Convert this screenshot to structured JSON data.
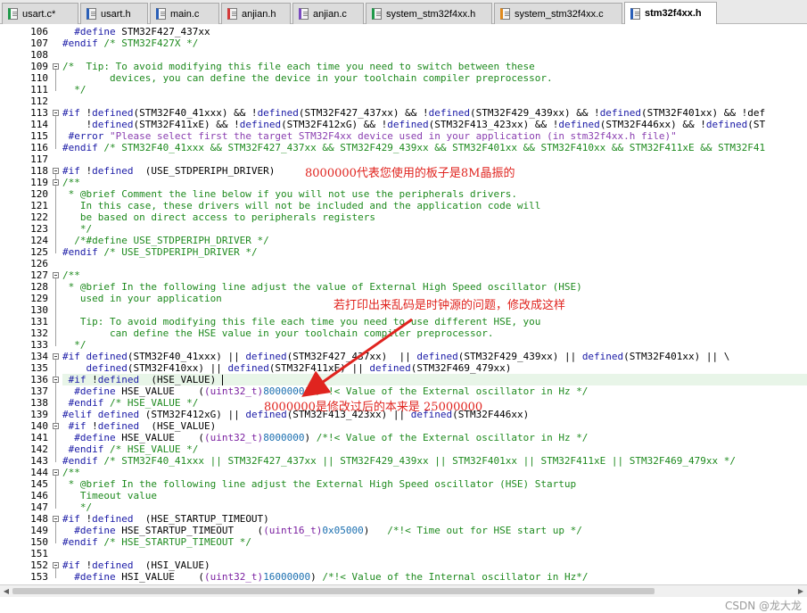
{
  "tabs": [
    {
      "label": "usart.c*",
      "icon": "c-file-icon",
      "accent": "#1f9a4a"
    },
    {
      "label": "usart.h",
      "icon": "h-file-icon",
      "accent": "#2a5fb8"
    },
    {
      "label": "main.c",
      "icon": "c-file-icon",
      "accent": "#2a5fb8"
    },
    {
      "label": "anjian.h",
      "icon": "h-file-icon",
      "accent": "#d43a3a"
    },
    {
      "label": "anjian.c",
      "icon": "c-file-icon",
      "accent": "#7a4bc0"
    },
    {
      "label": "system_stm32f4xx.h",
      "icon": "h-file-icon",
      "accent": "#1f9a4a"
    },
    {
      "label": "system_stm32f4xx.c",
      "icon": "c-file-icon",
      "accent": "#e08a1e"
    },
    {
      "label": "stm32f4xx.h",
      "icon": "h-file-icon",
      "accent": "#2a5fb8",
      "active": true
    }
  ],
  "lines": [
    {
      "n": "106",
      "text": "  #define STM32F427_437xx"
    },
    {
      "n": "107",
      "text": "#endif /* STM32F427X */"
    },
    {
      "n": "108",
      "text": ""
    },
    {
      "n": "109",
      "text": "/*  Tip: To avoid modifying this file each time you need to switch between these"
    },
    {
      "n": "110",
      "text": "        devices, you can define the device in your toolchain compiler preprocessor."
    },
    {
      "n": "111",
      "text": "  */"
    },
    {
      "n": "112",
      "text": ""
    },
    {
      "n": "113",
      "text": "#if !defined(STM32F40_41xxx) && !defined(STM32F427_437xx) && !defined(STM32F429_439xx) && !defined(STM32F401xx) && !def"
    },
    {
      "n": "114",
      "text": "    !defined(STM32F411xE) && !defined(STM32F412xG) && !defined(STM32F413_423xx) && !defined(STM32F446xx) && !defined(ST"
    },
    {
      "n": "115",
      "text": " #error \"Please select first the target STM32F4xx device used in your application (in stm32f4xx.h file)\""
    },
    {
      "n": "116",
      "text": "#endif /* STM32F40_41xxx && STM32F427_437xx && STM32F429_439xx && STM32F401xx && STM32F410xx && STM32F411xE && STM32F41"
    },
    {
      "n": "117",
      "text": ""
    },
    {
      "n": "118",
      "text": "#if !defined  (USE_STDPERIPH_DRIVER)"
    },
    {
      "n": "119",
      "text": "/**"
    },
    {
      "n": "120",
      "text": " * @brief Comment the line below if you will not use the peripherals drivers."
    },
    {
      "n": "121",
      "text": "   In this case, these drivers will not be included and the application code will"
    },
    {
      "n": "122",
      "text": "   be based on direct access to peripherals registers"
    },
    {
      "n": "123",
      "text": "   */"
    },
    {
      "n": "124",
      "text": "  /*#define USE_STDPERIPH_DRIVER */"
    },
    {
      "n": "125",
      "text": "#endif /* USE_STDPERIPH_DRIVER */"
    },
    {
      "n": "126",
      "text": ""
    },
    {
      "n": "127",
      "text": "/**"
    },
    {
      "n": "128",
      "text": " * @brief In the following line adjust the value of External High Speed oscillator (HSE)"
    },
    {
      "n": "129",
      "text": "   used in your application"
    },
    {
      "n": "130",
      "text": ""
    },
    {
      "n": "131",
      "text": "   Tip: To avoid modifying this file each time you need to use different HSE, you"
    },
    {
      "n": "132",
      "text": "        can define the HSE value in your toolchain compiler preprocessor."
    },
    {
      "n": "133",
      "text": "  */"
    },
    {
      "n": "134",
      "text": "#if defined(STM32F40_41xxx) || defined(STM32F427_437xx)  || defined(STM32F429_439xx) || defined(STM32F401xx) || \\"
    },
    {
      "n": "135",
      "text": "    defined(STM32F410xx) || defined(STM32F411xE) || defined(STM32F469_479xx)"
    },
    {
      "n": "136",
      "text": " #if !defined  (HSE_VALUE) "
    },
    {
      "n": "137",
      "text": "  #define HSE_VALUE    ((uint32_t)8000000) /*!< Value of the External oscillator in Hz */"
    },
    {
      "n": "138",
      "text": " #endif /* HSE_VALUE */"
    },
    {
      "n": "139",
      "text": "#elif defined (STM32F412xG) || defined(STM32F413_423xx) || defined(STM32F446xx)"
    },
    {
      "n": "140",
      "text": " #if !defined  (HSE_VALUE)"
    },
    {
      "n": "141",
      "text": "  #define HSE_VALUE    ((uint32_t)8000000) /*!< Value of the External oscillator in Hz */"
    },
    {
      "n": "142",
      "text": " #endif /* HSE_VALUE */"
    },
    {
      "n": "143",
      "text": "#endif /* STM32F40_41xxx || STM32F427_437xx || STM32F429_439xx || STM32F401xx || STM32F411xE || STM32F469_479xx */"
    },
    {
      "n": "144",
      "text": "/**"
    },
    {
      "n": "145",
      "text": " * @brief In the following line adjust the External High Speed oscillator (HSE) Startup"
    },
    {
      "n": "146",
      "text": "   Timeout value"
    },
    {
      "n": "147",
      "text": "   */"
    },
    {
      "n": "148",
      "text": "#if !defined  (HSE_STARTUP_TIMEOUT)"
    },
    {
      "n": "149",
      "text": "  #define HSE_STARTUP_TIMEOUT    ((uint16_t)0x05000)   /*!< Time out for HSE start up */"
    },
    {
      "n": "150",
      "text": "#endif /* HSE_STARTUP_TIMEOUT */"
    },
    {
      "n": "151",
      "text": ""
    },
    {
      "n": "152",
      "text": "#if !defined  (HSI_VALUE)"
    },
    {
      "n": "153",
      "text": "  #define HSI_VALUE    ((uint32_t)16000000) /*!< Value of the Internal oscillator in Hz*/"
    }
  ],
  "annotations": {
    "board_crystal": "8000000代表您使用的板子是8M晶振的",
    "garbled_fix": "若打印出来乱码是时钟源的问题，修改成这样",
    "modified_value": "8000000是修改过后的本来是 25000000"
  },
  "watermark": "CSDN @龙大龙",
  "colors": {
    "keyword": "#1a1aa6",
    "comment": "#1e8a1e",
    "number": "#1b6fb0",
    "annotation": "#e0241f",
    "current_line": "#e8f5e8"
  }
}
